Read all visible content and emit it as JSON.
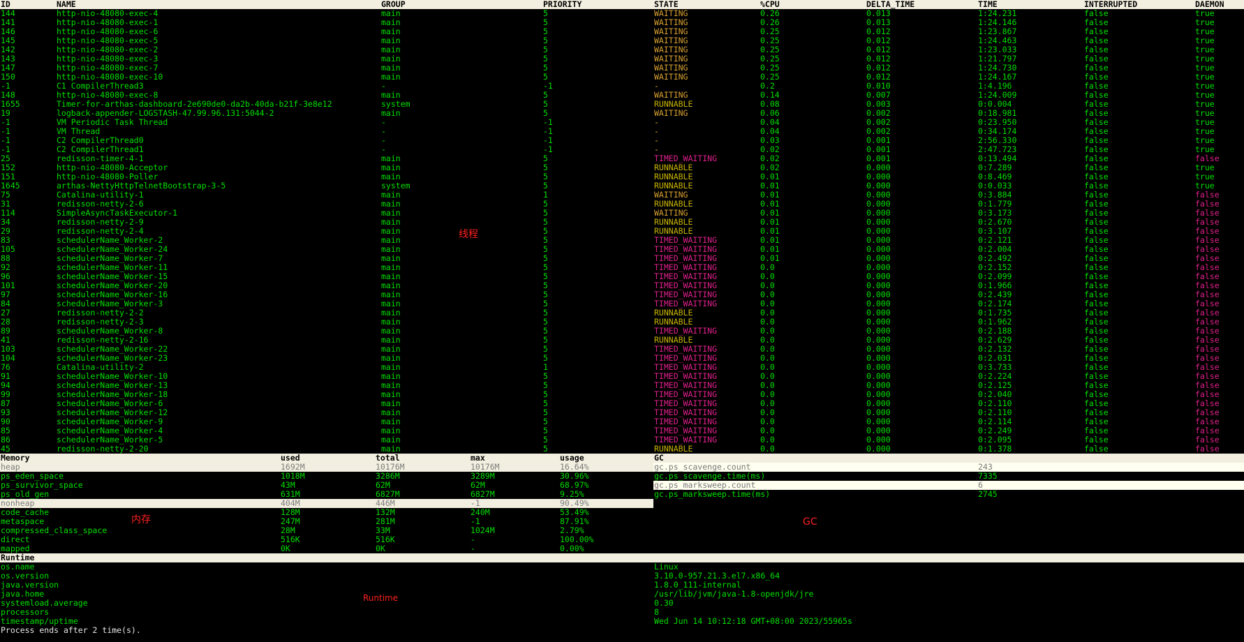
{
  "threads": {
    "headers": [
      "ID",
      "NAME",
      "GROUP",
      "PRIORITY",
      "STATE",
      "%CPU",
      "DELTA_TIME",
      "TIME",
      "INTERRUPTED",
      "DAEMON"
    ],
    "rows": [
      [
        "144",
        "http-nio-48080-exec-4",
        "main",
        "5",
        "WAITING",
        "0.26",
        "0.013",
        "1:24.231",
        "false",
        "true"
      ],
      [
        "141",
        "http-nio-48080-exec-1",
        "main",
        "5",
        "WAITING",
        "0.26",
        "0.013",
        "1:24.146",
        "false",
        "true"
      ],
      [
        "146",
        "http-nio-48080-exec-6",
        "main",
        "5",
        "WAITING",
        "0.25",
        "0.012",
        "1:23.867",
        "false",
        "true"
      ],
      [
        "145",
        "http-nio-48080-exec-5",
        "main",
        "5",
        "WAITING",
        "0.25",
        "0.012",
        "1:24.463",
        "false",
        "true"
      ],
      [
        "142",
        "http-nio-48080-exec-2",
        "main",
        "5",
        "WAITING",
        "0.25",
        "0.012",
        "1:23.033",
        "false",
        "true"
      ],
      [
        "143",
        "http-nio-48080-exec-3",
        "main",
        "5",
        "WAITING",
        "0.25",
        "0.012",
        "1:21.797",
        "false",
        "true"
      ],
      [
        "147",
        "http-nio-48080-exec-7",
        "main",
        "5",
        "WAITING",
        "0.25",
        "0.012",
        "1:24.730",
        "false",
        "true"
      ],
      [
        "150",
        "http-nio-48080-exec-10",
        "main",
        "5",
        "WAITING",
        "0.25",
        "0.012",
        "1:24.167",
        "false",
        "true"
      ],
      [
        "-1",
        "C1 CompilerThread3",
        "-",
        "-1",
        "-",
        "0.2",
        "0.010",
        "1:4.196",
        "false",
        "true"
      ],
      [
        "148",
        "http-nio-48080-exec-8",
        "main",
        "5",
        "WAITING",
        "0.14",
        "0.007",
        "1:24.009",
        "false",
        "true"
      ],
      [
        "1655",
        "Timer-for-arthas-dashboard-2e690de0-da2b-40da-b21f-3e8e12",
        "system",
        "5",
        "RUNNABLE",
        "0.08",
        "0.003",
        "0:0.004",
        "false",
        "true"
      ],
      [
        "19",
        "logback-appender-LOGSTASH-47.99.96.131:5044-2",
        "main",
        "5",
        "WAITING",
        "0.06",
        "0.002",
        "0:18.981",
        "false",
        "true"
      ],
      [
        "-1",
        "VM Periodic Task Thread",
        "-",
        "-1",
        "-",
        "0.04",
        "0.002",
        "0:23.950",
        "false",
        "true"
      ],
      [
        "-1",
        "VM Thread",
        "-",
        "-1",
        "-",
        "0.04",
        "0.002",
        "0:34.174",
        "false",
        "true"
      ],
      [
        "-1",
        "C2 CompilerThread0",
        "-",
        "-1",
        "-",
        "0.03",
        "0.001",
        "2:56.330",
        "false",
        "true"
      ],
      [
        "-1",
        "C2 CompilerThread1",
        "-",
        "-1",
        "-",
        "0.02",
        "0.001",
        "2:47.723",
        "false",
        "true"
      ],
      [
        "25",
        "redisson-timer-4-1",
        "main",
        "5",
        "TIMED_WAITING",
        "0.02",
        "0.001",
        "0:13.494",
        "false",
        "false"
      ],
      [
        "152",
        "http-nio-48080-Acceptor",
        "main",
        "5",
        "RUNNABLE",
        "0.02",
        "0.000",
        "0:7.289",
        "false",
        "true"
      ],
      [
        "151",
        "http-nio-48080-Poller",
        "main",
        "5",
        "RUNNABLE",
        "0.01",
        "0.000",
        "0:8.469",
        "false",
        "true"
      ],
      [
        "1645",
        "arthas-NettyHttpTelnetBootstrap-3-5",
        "system",
        "5",
        "RUNNABLE",
        "0.01",
        "0.000",
        "0:0.033",
        "false",
        "true"
      ],
      [
        "75",
        "Catalina-utility-1",
        "main",
        "1",
        "WAITING",
        "0.01",
        "0.000",
        "0:3.884",
        "false",
        "false"
      ],
      [
        "31",
        "redisson-netty-2-6",
        "main",
        "5",
        "RUNNABLE",
        "0.01",
        "0.000",
        "0:1.779",
        "false",
        "false"
      ],
      [
        "114",
        "SimpleAsyncTaskExecutor-1",
        "main",
        "5",
        "WAITING",
        "0.01",
        "0.000",
        "0:3.173",
        "false",
        "false"
      ],
      [
        "34",
        "redisson-netty-2-9",
        "main",
        "5",
        "RUNNABLE",
        "0.01",
        "0.000",
        "0:2.670",
        "false",
        "false"
      ],
      [
        "29",
        "redisson-netty-2-4",
        "main",
        "5",
        "RUNNABLE",
        "0.01",
        "0.000",
        "0:3.107",
        "false",
        "false"
      ],
      [
        "83",
        "schedulerName_Worker-2",
        "main",
        "5",
        "TIMED_WAITING",
        "0.01",
        "0.000",
        "0:2.121",
        "false",
        "false"
      ],
      [
        "105",
        "schedulerName_Worker-24",
        "main",
        "5",
        "TIMED_WAITING",
        "0.01",
        "0.000",
        "0:2.004",
        "false",
        "false"
      ],
      [
        "88",
        "schedulerName_Worker-7",
        "main",
        "5",
        "TIMED_WAITING",
        "0.01",
        "0.000",
        "0:2.492",
        "false",
        "false"
      ],
      [
        "92",
        "schedulerName_Worker-11",
        "main",
        "5",
        "TIMED_WAITING",
        "0.0",
        "0.000",
        "0:2.152",
        "false",
        "false"
      ],
      [
        "96",
        "schedulerName_Worker-15",
        "main",
        "5",
        "TIMED_WAITING",
        "0.0",
        "0.000",
        "0:2.099",
        "false",
        "false"
      ],
      [
        "101",
        "schedulerName_Worker-20",
        "main",
        "5",
        "TIMED_WAITING",
        "0.0",
        "0.000",
        "0:1.966",
        "false",
        "false"
      ],
      [
        "97",
        "schedulerName_Worker-16",
        "main",
        "5",
        "TIMED_WAITING",
        "0.0",
        "0.000",
        "0:2.439",
        "false",
        "false"
      ],
      [
        "84",
        "schedulerName_Worker-3",
        "main",
        "5",
        "TIMED_WAITING",
        "0.0",
        "0.000",
        "0:2.174",
        "false",
        "false"
      ],
      [
        "27",
        "redisson-netty-2-2",
        "main",
        "5",
        "RUNNABLE",
        "0.0",
        "0.000",
        "0:1.735",
        "false",
        "false"
      ],
      [
        "28",
        "redisson-netty-2-3",
        "main",
        "5",
        "RUNNABLE",
        "0.0",
        "0.000",
        "0:1.962",
        "false",
        "false"
      ],
      [
        "89",
        "schedulerName_Worker-8",
        "main",
        "5",
        "TIMED_WAITING",
        "0.0",
        "0.000",
        "0:2.188",
        "false",
        "false"
      ],
      [
        "41",
        "redisson-netty-2-16",
        "main",
        "5",
        "RUNNABLE",
        "0.0",
        "0.000",
        "0:2.629",
        "false",
        "false"
      ],
      [
        "103",
        "schedulerName_Worker-22",
        "main",
        "5",
        "TIMED_WAITING",
        "0.0",
        "0.000",
        "0:2.132",
        "false",
        "false"
      ],
      [
        "104",
        "schedulerName_Worker-23",
        "main",
        "5",
        "TIMED_WAITING",
        "0.0",
        "0.000",
        "0:2.031",
        "false",
        "false"
      ],
      [
        "76",
        "Catalina-utility-2",
        "main",
        "1",
        "TIMED_WAITING",
        "0.0",
        "0.000",
        "0:3.733",
        "false",
        "false"
      ],
      [
        "91",
        "schedulerName_Worker-10",
        "main",
        "5",
        "TIMED_WAITING",
        "0.0",
        "0.000",
        "0:2.224",
        "false",
        "false"
      ],
      [
        "94",
        "schedulerName_Worker-13",
        "main",
        "5",
        "TIMED_WAITING",
        "0.0",
        "0.000",
        "0:2.125",
        "false",
        "false"
      ],
      [
        "99",
        "schedulerName_Worker-18",
        "main",
        "5",
        "TIMED_WAITING",
        "0.0",
        "0.000",
        "0:2.040",
        "false",
        "false"
      ],
      [
        "87",
        "schedulerName_Worker-6",
        "main",
        "5",
        "TIMED_WAITING",
        "0.0",
        "0.000",
        "0:2.110",
        "false",
        "false"
      ],
      [
        "93",
        "schedulerName_Worker-12",
        "main",
        "5",
        "TIMED_WAITING",
        "0.0",
        "0.000",
        "0:2.110",
        "false",
        "false"
      ],
      [
        "90",
        "schedulerName_Worker-9",
        "main",
        "5",
        "TIMED_WAITING",
        "0.0",
        "0.000",
        "0:2.114",
        "false",
        "false"
      ],
      [
        "85",
        "schedulerName_Worker-4",
        "main",
        "5",
        "TIMED_WAITING",
        "0.0",
        "0.000",
        "0:2.249",
        "false",
        "false"
      ],
      [
        "86",
        "schedulerName_Worker-5",
        "main",
        "5",
        "TIMED_WAITING",
        "0.0",
        "0.000",
        "0:2.095",
        "false",
        "false"
      ],
      [
        "45",
        "redisson-netty-2-20",
        "main",
        "5",
        "RUNNABLE",
        "0.0",
        "0.000",
        "0:1.378",
        "false",
        "false"
      ]
    ],
    "annotation": "线程"
  },
  "memory": {
    "headers": [
      "Memory",
      "used",
      "total",
      "max",
      "usage"
    ],
    "rows": [
      [
        "heap",
        "1692M",
        "10176M",
        "10176M",
        "16.64%"
      ],
      [
        "ps_eden_space",
        "1018M",
        "3286M",
        "3289M",
        "30.96%"
      ],
      [
        "ps_survivor_space",
        "43M",
        "62M",
        "62M",
        "68.97%"
      ],
      [
        "ps_old_gen",
        "631M",
        "6827M",
        "6827M",
        "9.25%"
      ],
      [
        "nonheap",
        "404M",
        "446M",
        "-1",
        "90.49%"
      ],
      [
        "code_cache",
        "128M",
        "132M",
        "240M",
        "53.49%"
      ],
      [
        "metaspace",
        "247M",
        "281M",
        "-1",
        "87.91%"
      ],
      [
        "compressed_class_space",
        "28M",
        "33M",
        "1024M",
        "2.79%"
      ],
      [
        "direct",
        "516K",
        "516K",
        "-",
        "100.00%"
      ],
      [
        "mapped",
        "0K",
        "0K",
        "-",
        "0.00%"
      ]
    ],
    "highlighted": [
      0,
      4
    ],
    "annotation": "内存"
  },
  "gc": {
    "header": "GC",
    "rows": [
      [
        "gc.ps_scavenge.count",
        "243"
      ],
      [
        "gc.ps_scavenge.time(ms)",
        "7335"
      ],
      [
        "gc.ps_marksweep.count",
        "6"
      ],
      [
        "gc.ps_marksweep.time(ms)",
        "2745"
      ]
    ],
    "highlighted": [
      0,
      2
    ],
    "annotation": "GC"
  },
  "runtime": {
    "header": "Runtime",
    "rows": [
      [
        "os.name",
        "Linux"
      ],
      [
        "os.version",
        "3.10.0-957.21.3.el7.x86_64"
      ],
      [
        "java.version",
        "1.8.0_111-internal"
      ],
      [
        "java.home",
        "/usr/lib/jvm/java-1.8-openjdk/jre"
      ],
      [
        "systemload.average",
        "0.30"
      ],
      [
        "processors",
        "8"
      ],
      [
        "timestamp/uptime",
        "Wed Jun 14 10:12:18 GMT+08:00 2023/55965s"
      ]
    ],
    "annotation": "Runtime",
    "footer": "Process ends after 2 time(s)."
  }
}
